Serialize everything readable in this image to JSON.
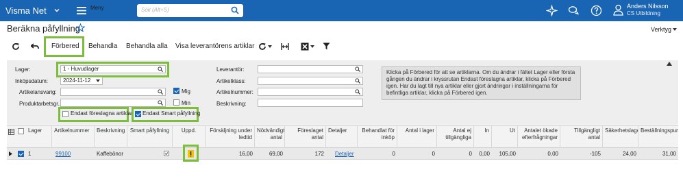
{
  "topbar": {
    "brand": "Visma Net",
    "menu_label": "Meny",
    "search_placeholder": "Sök (Alt+S)",
    "user_name": "Anders Nilsson",
    "user_company": "CS Utbildning",
    "bg_color": "#1a64b4"
  },
  "page": {
    "title": "Beräkna påfyllning",
    "tools_label": "Verktyg"
  },
  "toolbar": {
    "prepare_label": "Förbered",
    "process_label": "Behandla",
    "process_all_label": "Behandla alla",
    "view_vendor_label": "Visa leverantörens artiklar"
  },
  "form": {
    "warehouse_label": "Lager:",
    "warehouse_value": "1 - Huvudlager",
    "purchase_date_label": "Inköpsdatum:",
    "purchase_date_value": "2024-11-12",
    "article_manager_label": "Artikelansvarig:",
    "product_manager_label": "Produktarbetsgr...",
    "mine_label": "Mig",
    "min_label": "Min",
    "only_suggested_label": "Endast föreslagna artiklar",
    "only_smart_label": "Endast Smart påfyllning",
    "supplier_label": "Leverantör:",
    "article_class_label": "Artikelklass:",
    "article_number_label": "Artikelnummer:",
    "description_label": "Beskrivning:",
    "info_text": "Klicka på Förbered för att se artiklarna. Om du ändrar i fältet Lager eller första gången du ändrar i kryssrutan Endast föreslagna artiklar, klicka på Förbered igen. Har du lagt till nya artiklar eller gjort ändringar i inställningarna för befintliga artiklar, klicka på Förbered igen.",
    "mine_checked": true,
    "min_checked": false,
    "only_suggested_checked": false,
    "only_smart_checked": true
  },
  "grid": {
    "headers": {
      "warehouse": "Lager",
      "article_number": "Artikelnummer",
      "description": "Beskrivning",
      "smart": "Smart påfyllning",
      "updated": "Uppd.",
      "sales_lead": "Försäljning under ledtid",
      "required": "Nödvändigt antal",
      "suggested": "Föreslaget antal",
      "details": "Detaljer",
      "processed": "Behandlat för inköp",
      "in_stock": "Antal i lager",
      "not_available": "Antal ej tillgängliga",
      "in": "In",
      "out": "Ut",
      "increased_demand": "Antalet ökade efterfrågningar",
      "available": "Tillgängligt antal",
      "safety": "Säkerhetslager",
      "order_point": "Beställningspunkt"
    },
    "row": {
      "warehouse": "1",
      "article_number": "99100",
      "description": "Kaffebönor",
      "sales_lead": "16,00",
      "required": "69,00",
      "suggested": "172",
      "details": "Detaljer",
      "processed": "0",
      "in_stock": "0",
      "not_available": "0",
      "in": "0,00",
      "out": "105,00",
      "increased_demand": "0,00",
      "available": "-105",
      "safety": "24,00",
      "order_point": "31,00"
    }
  },
  "colors": {
    "highlight_green": "#7cbd3b",
    "warning_yellow": "#f5c400"
  }
}
